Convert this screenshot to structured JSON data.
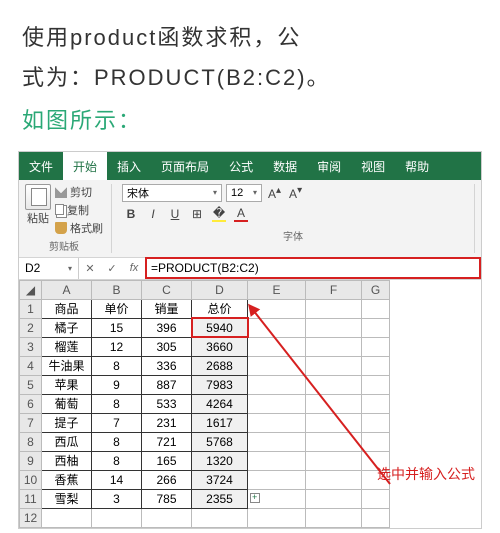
{
  "article": {
    "line1": "使用product函数求积，公",
    "line2": "式为：PRODUCT(B2:C2)。",
    "hint": "如图所示："
  },
  "ribbon": {
    "tabs": [
      "文件",
      "开始",
      "插入",
      "页面布局",
      "公式",
      "数据",
      "审阅",
      "视图",
      "帮助"
    ],
    "activeIndex": 1
  },
  "clipboard": {
    "paste": "粘贴",
    "cut": "剪切",
    "copy": "复制",
    "format": "格式刷",
    "groupLabel": "剪贴板"
  },
  "font": {
    "name": "宋体",
    "size": "12",
    "groupLabel": "字体"
  },
  "formulaBar": {
    "cellRef": "D2",
    "formula": "=PRODUCT(B2:C2)"
  },
  "annotation": "选中并输入公式",
  "chart_data": {
    "type": "table",
    "columns": [
      "商品",
      "单价",
      "销量",
      "总价"
    ],
    "rows": [
      {
        "商品": "橘子",
        "单价": 15,
        "销量": 396,
        "总价": 5940
      },
      {
        "商品": "榴莲",
        "单价": 12,
        "销量": 305,
        "总价": 3660
      },
      {
        "商品": "牛油果",
        "单价": 8,
        "销量": 336,
        "总价": 2688
      },
      {
        "商品": "苹果",
        "单价": 9,
        "销量": 887,
        "总价": 7983
      },
      {
        "商品": "葡萄",
        "单价": 8,
        "销量": 533,
        "总价": 4264
      },
      {
        "商品": "提子",
        "单价": 7,
        "销量": 231,
        "总价": 1617
      },
      {
        "商品": "西瓜",
        "单价": 8,
        "销量": 721,
        "总价": 5768
      },
      {
        "商品": "西柚",
        "单价": 8,
        "销量": 165,
        "总价": 1320
      },
      {
        "商品": "香蕉",
        "单价": 14,
        "销量": 266,
        "总价": 3724
      },
      {
        "商品": "雪梨",
        "单价": 3,
        "销量": 785,
        "总价": 2355
      }
    ],
    "colLetters": [
      "A",
      "B",
      "C",
      "D",
      "E",
      "F",
      "G"
    ],
    "rowNumbers": [
      1,
      2,
      3,
      4,
      5,
      6,
      7,
      8,
      9,
      10,
      11,
      12
    ]
  }
}
